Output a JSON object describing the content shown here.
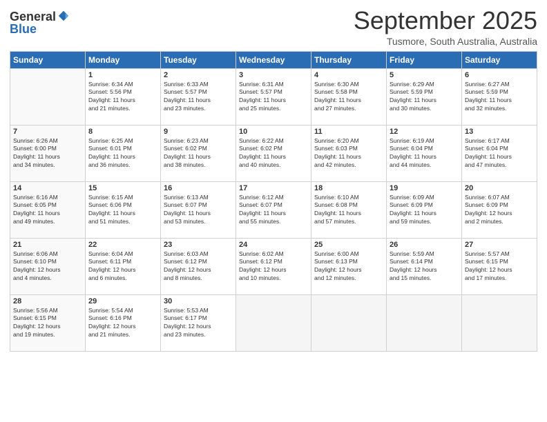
{
  "logo": {
    "general": "General",
    "blue": "Blue"
  },
  "title": "September 2025",
  "location": "Tusmore, South Australia, Australia",
  "days_of_week": [
    "Sunday",
    "Monday",
    "Tuesday",
    "Wednesday",
    "Thursday",
    "Friday",
    "Saturday"
  ],
  "weeks": [
    [
      {
        "day": "",
        "content": ""
      },
      {
        "day": "1",
        "content": "Sunrise: 6:34 AM\nSunset: 5:56 PM\nDaylight: 11 hours\nand 21 minutes."
      },
      {
        "day": "2",
        "content": "Sunrise: 6:33 AM\nSunset: 5:57 PM\nDaylight: 11 hours\nand 23 minutes."
      },
      {
        "day": "3",
        "content": "Sunrise: 6:31 AM\nSunset: 5:57 PM\nDaylight: 11 hours\nand 25 minutes."
      },
      {
        "day": "4",
        "content": "Sunrise: 6:30 AM\nSunset: 5:58 PM\nDaylight: 11 hours\nand 27 minutes."
      },
      {
        "day": "5",
        "content": "Sunrise: 6:29 AM\nSunset: 5:59 PM\nDaylight: 11 hours\nand 30 minutes."
      },
      {
        "day": "6",
        "content": "Sunrise: 6:27 AM\nSunset: 5:59 PM\nDaylight: 11 hours\nand 32 minutes."
      }
    ],
    [
      {
        "day": "7",
        "content": "Sunrise: 6:26 AM\nSunset: 6:00 PM\nDaylight: 11 hours\nand 34 minutes."
      },
      {
        "day": "8",
        "content": "Sunrise: 6:25 AM\nSunset: 6:01 PM\nDaylight: 11 hours\nand 36 minutes."
      },
      {
        "day": "9",
        "content": "Sunrise: 6:23 AM\nSunset: 6:02 PM\nDaylight: 11 hours\nand 38 minutes."
      },
      {
        "day": "10",
        "content": "Sunrise: 6:22 AM\nSunset: 6:02 PM\nDaylight: 11 hours\nand 40 minutes."
      },
      {
        "day": "11",
        "content": "Sunrise: 6:20 AM\nSunset: 6:03 PM\nDaylight: 11 hours\nand 42 minutes."
      },
      {
        "day": "12",
        "content": "Sunrise: 6:19 AM\nSunset: 6:04 PM\nDaylight: 11 hours\nand 44 minutes."
      },
      {
        "day": "13",
        "content": "Sunrise: 6:17 AM\nSunset: 6:04 PM\nDaylight: 11 hours\nand 47 minutes."
      }
    ],
    [
      {
        "day": "14",
        "content": "Sunrise: 6:16 AM\nSunset: 6:05 PM\nDaylight: 11 hours\nand 49 minutes."
      },
      {
        "day": "15",
        "content": "Sunrise: 6:15 AM\nSunset: 6:06 PM\nDaylight: 11 hours\nand 51 minutes."
      },
      {
        "day": "16",
        "content": "Sunrise: 6:13 AM\nSunset: 6:07 PM\nDaylight: 11 hours\nand 53 minutes."
      },
      {
        "day": "17",
        "content": "Sunrise: 6:12 AM\nSunset: 6:07 PM\nDaylight: 11 hours\nand 55 minutes."
      },
      {
        "day": "18",
        "content": "Sunrise: 6:10 AM\nSunset: 6:08 PM\nDaylight: 11 hours\nand 57 minutes."
      },
      {
        "day": "19",
        "content": "Sunrise: 6:09 AM\nSunset: 6:09 PM\nDaylight: 11 hours\nand 59 minutes."
      },
      {
        "day": "20",
        "content": "Sunrise: 6:07 AM\nSunset: 6:09 PM\nDaylight: 12 hours\nand 2 minutes."
      }
    ],
    [
      {
        "day": "21",
        "content": "Sunrise: 6:06 AM\nSunset: 6:10 PM\nDaylight: 12 hours\nand 4 minutes."
      },
      {
        "day": "22",
        "content": "Sunrise: 6:04 AM\nSunset: 6:11 PM\nDaylight: 12 hours\nand 6 minutes."
      },
      {
        "day": "23",
        "content": "Sunrise: 6:03 AM\nSunset: 6:12 PM\nDaylight: 12 hours\nand 8 minutes."
      },
      {
        "day": "24",
        "content": "Sunrise: 6:02 AM\nSunset: 6:12 PM\nDaylight: 12 hours\nand 10 minutes."
      },
      {
        "day": "25",
        "content": "Sunrise: 6:00 AM\nSunset: 6:13 PM\nDaylight: 12 hours\nand 12 minutes."
      },
      {
        "day": "26",
        "content": "Sunrise: 5:59 AM\nSunset: 6:14 PM\nDaylight: 12 hours\nand 15 minutes."
      },
      {
        "day": "27",
        "content": "Sunrise: 5:57 AM\nSunset: 6:15 PM\nDaylight: 12 hours\nand 17 minutes."
      }
    ],
    [
      {
        "day": "28",
        "content": "Sunrise: 5:56 AM\nSunset: 6:15 PM\nDaylight: 12 hours\nand 19 minutes."
      },
      {
        "day": "29",
        "content": "Sunrise: 5:54 AM\nSunset: 6:16 PM\nDaylight: 12 hours\nand 21 minutes."
      },
      {
        "day": "30",
        "content": "Sunrise: 5:53 AM\nSunset: 6:17 PM\nDaylight: 12 hours\nand 23 minutes."
      },
      {
        "day": "",
        "content": ""
      },
      {
        "day": "",
        "content": ""
      },
      {
        "day": "",
        "content": ""
      },
      {
        "day": "",
        "content": ""
      }
    ]
  ]
}
